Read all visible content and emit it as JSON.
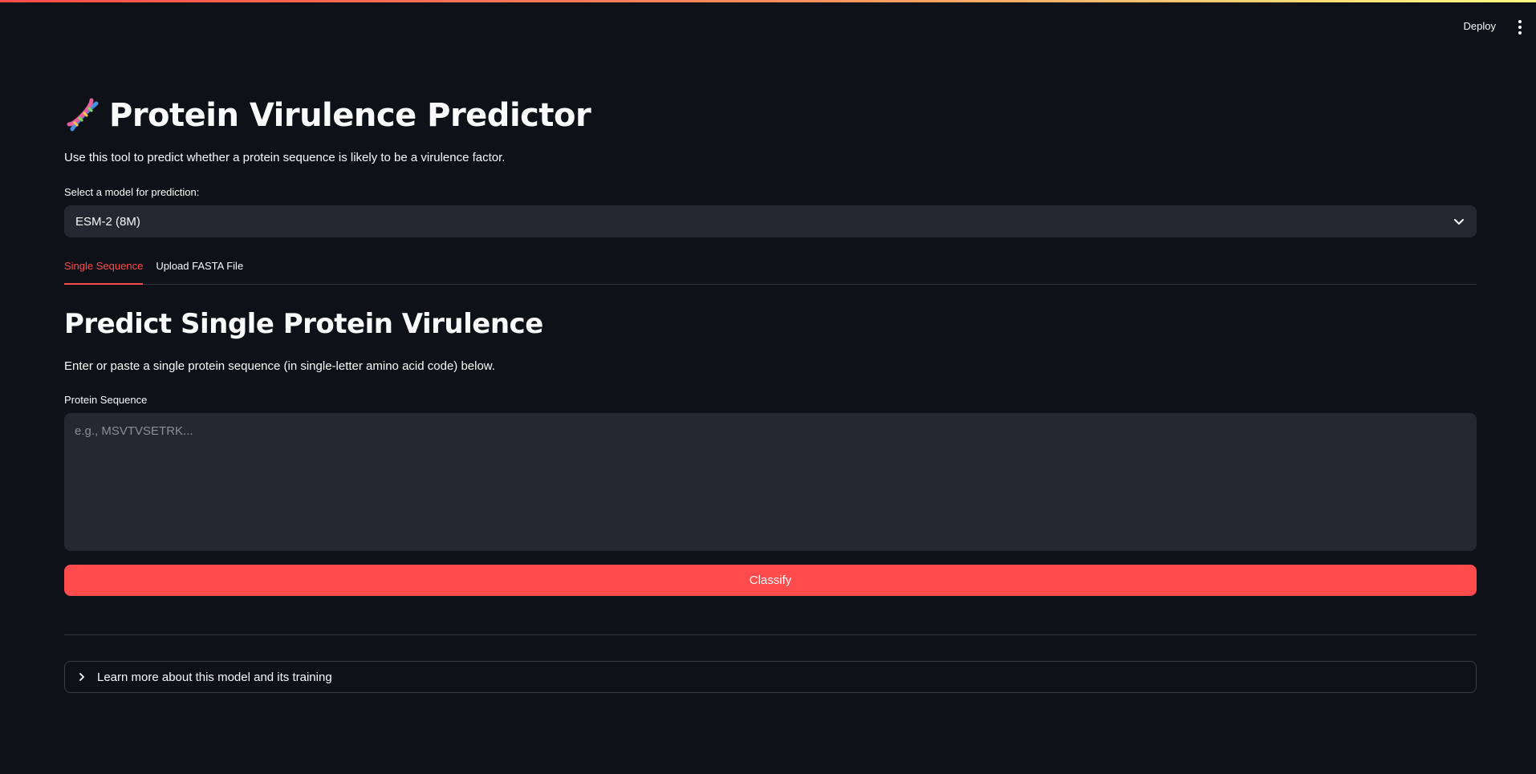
{
  "header": {
    "deploy_label": "Deploy",
    "menu_icon": "more-vertical-icon"
  },
  "app": {
    "title_icon": "dna-icon",
    "title": "Protein Virulence Predictor",
    "description": "Use this tool to predict whether a protein sequence is likely to be a virulence factor."
  },
  "model_select": {
    "label": "Select a model for prediction:",
    "value": "ESM-2 (8M)",
    "icon": "chevron-down-icon"
  },
  "tabs": [
    {
      "label": "Single Sequence",
      "active": true
    },
    {
      "label": "Upload FASTA File",
      "active": false
    }
  ],
  "single": {
    "heading": "Predict Single Protein Virulence",
    "instructions": "Enter or paste a single protein sequence (in single-letter amino acid code) below.",
    "input_label": "Protein Sequence",
    "input_placeholder": "e.g., MSVTVSETRK...",
    "input_value": "",
    "submit_label": "Classify"
  },
  "expander": {
    "label": "Learn more about this model and its training",
    "icon": "chevron-right-icon"
  },
  "colors": {
    "background": "#0e1117",
    "surface": "#262730",
    "accent": "#ff4b4b",
    "text": "#fafafa"
  }
}
